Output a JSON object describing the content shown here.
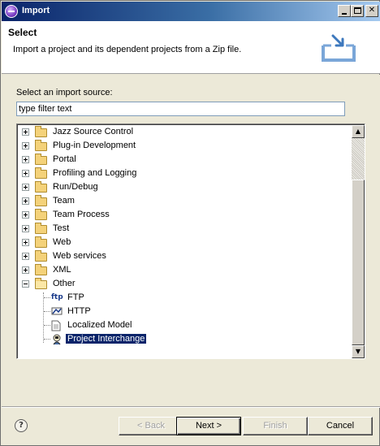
{
  "window": {
    "title": "Import"
  },
  "header": {
    "title": "Select",
    "description": "Import a project and its dependent projects from a Zip file."
  },
  "source": {
    "label": "Select an import source:",
    "filter_value": "type filter text"
  },
  "tree": {
    "items": [
      {
        "label": "Jazz Source Control"
      },
      {
        "label": "Plug-in Development"
      },
      {
        "label": "Portal"
      },
      {
        "label": "Profiling and Logging"
      },
      {
        "label": "Run/Debug"
      },
      {
        "label": "Team"
      },
      {
        "label": "Team Process"
      },
      {
        "label": "Test"
      },
      {
        "label": "Web"
      },
      {
        "label": "Web services"
      },
      {
        "label": "XML"
      },
      {
        "label": "Other"
      }
    ],
    "other_children": [
      {
        "label": "FTP",
        "icon": "ftp-icon",
        "glyph": "ftp"
      },
      {
        "label": "HTTP",
        "icon": "http-icon",
        "glyph": ""
      },
      {
        "label": "Localized Model",
        "icon": "document-icon",
        "glyph": ""
      },
      {
        "label": "Project Interchange",
        "icon": "project-interchange-icon",
        "glyph": "",
        "selected": true
      }
    ]
  },
  "buttons": {
    "back": "< Back",
    "next": "Next >",
    "finish": "Finish",
    "cancel": "Cancel",
    "help": "?"
  },
  "colors": {
    "selection": "#0a246a",
    "title_bar": "#0a246a"
  }
}
